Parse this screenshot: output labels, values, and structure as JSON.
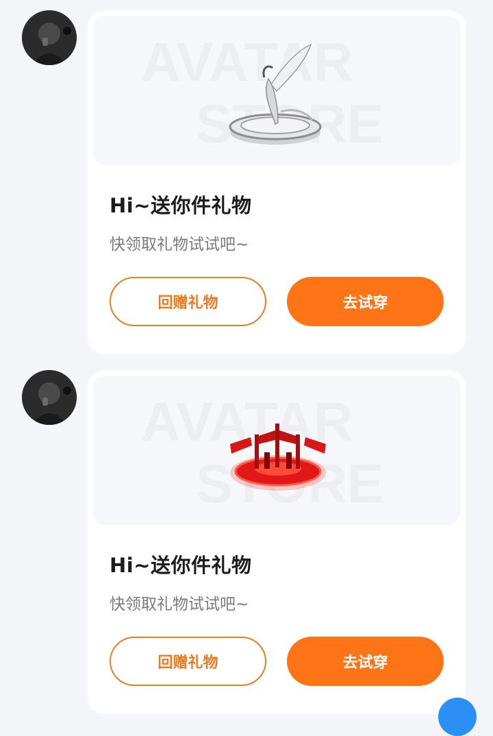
{
  "colors": {
    "page_background": "#f3f5f9",
    "accent_orange": "#ff7416",
    "floating_button_blue": "#2b8ff5"
  },
  "messages": [
    {
      "watermark": [
        "AVATAR",
        "STORE"
      ],
      "gift_icon": "silver-feather-pedestal-icon",
      "title": "Hi~送你件礼物",
      "subtitle": "快领取礼物试试吧~",
      "return_gift_label": "回赠礼物",
      "try_on_label": "去试穿"
    },
    {
      "watermark": [
        "AVATAR",
        "STORE"
      ],
      "gift_icon": "red-glowing-platform-icon",
      "title": "Hi~送你件礼物",
      "subtitle": "快领取礼物试试吧~",
      "return_gift_label": "回赠礼物",
      "try_on_label": "去试穿"
    }
  ]
}
